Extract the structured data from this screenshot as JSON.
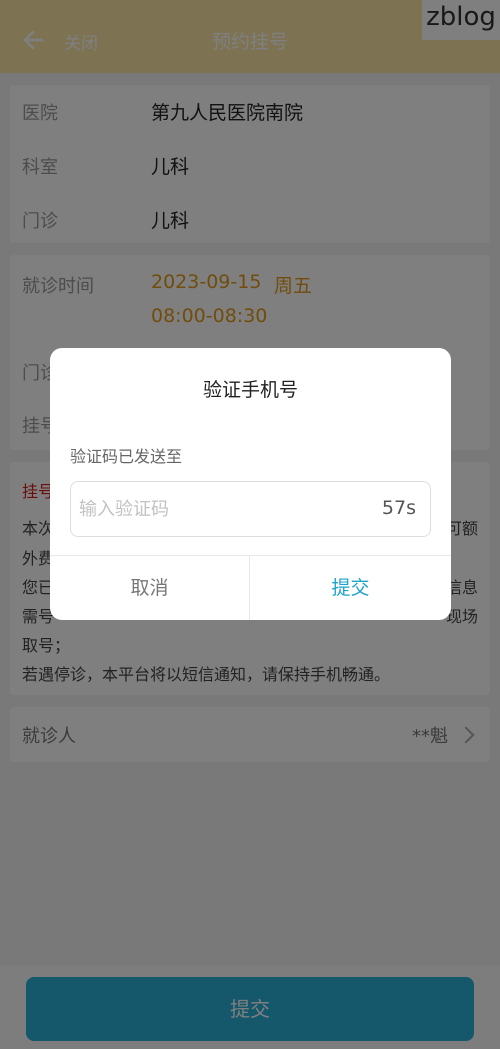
{
  "header": {
    "close_label": "关闭",
    "title": "预约挂号",
    "watermark": "zblog"
  },
  "info": {
    "hospital_label": "医院",
    "hospital_value": "第九人民医院南院",
    "department_label": "科室",
    "department_value": "儿科",
    "clinic_label": "门诊",
    "clinic_value": "儿科"
  },
  "visit": {
    "time_label": "就诊时间",
    "date_value": "2023-09-15",
    "weekday_value": "周五",
    "time_range": "08:00-08:30",
    "partial_label_1": "门诊",
    "partial_label_2": "挂号"
  },
  "notice": {
    "title_partial": "挂号",
    "line1": "本次",
    "line1_right": "可额",
    "line2": "外费",
    "line3": "您已",
    "line3_right": "信息",
    "line4_left": "需号",
    "line4_right": "现场",
    "line5": "取号；",
    "line6": "若遇停诊，本平台将以短信通知，请保持手机畅通。"
  },
  "patient": {
    "label": "就诊人",
    "value": "**魁"
  },
  "bottom": {
    "submit_label": "提交"
  },
  "dialog": {
    "title": "验证手机号",
    "sent_label": "验证码已发送至",
    "input_placeholder": "输入验证码",
    "input_value": "",
    "countdown": "57s",
    "cancel_label": "取消",
    "confirm_label": "提交"
  },
  "colors": {
    "header_bg": "#fbe6a6",
    "accent": "#2ab0d6",
    "time_highlight": "#e29a1b",
    "notice_title": "#d61b1b"
  }
}
